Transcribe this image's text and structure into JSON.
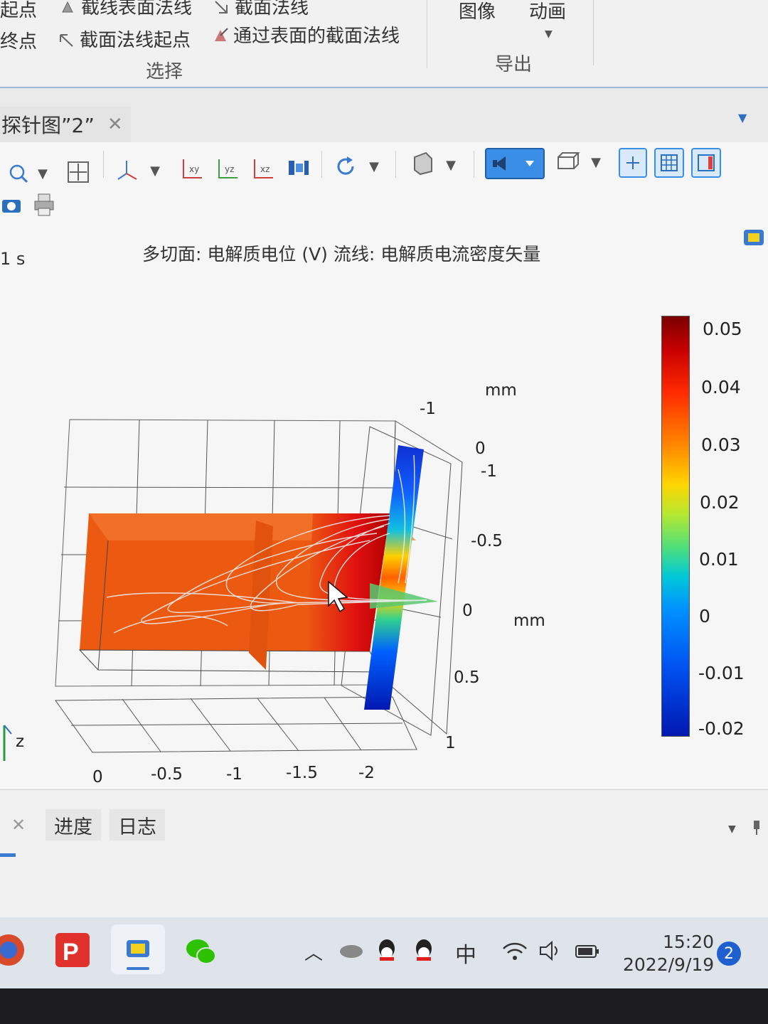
{
  "ribbon": {
    "items": {
      "top_left_partial": "起点",
      "mid_left_partial": "终点",
      "line_surface_normal": "截线表面法线",
      "section_normal_top": "截面法线",
      "section_normal_start": "截面法线起点",
      "section_normal_through_surface": "通过表面的截面法线"
    },
    "group_select": "选择",
    "export": {
      "image": "图像",
      "animation": "动画",
      "group": "导出"
    }
  },
  "tab": {
    "title": "探针图”2”"
  },
  "plot": {
    "time_label": "1 s",
    "title": "多切面: 电解质电位 (V)  流线: 电解质电流密度矢量"
  },
  "axes": {
    "unit_label_top": "mm",
    "unit_label_right": "mm",
    "vertical_ticks": [
      "-1",
      "0",
      "-1",
      "-0.5",
      "0",
      "0.5",
      "1"
    ],
    "horizontal_ticks": [
      "0",
      "-0.5",
      "-1",
      "-1.5",
      "-2"
    ],
    "axis_letter_z": "z"
  },
  "colorbar": {
    "ticks": [
      "0.05",
      "0.04",
      "0.03",
      "0.02",
      "0.01",
      "0",
      "-0.01",
      "-0.02"
    ],
    "colors": [
      "#7a0000",
      "#ff2a00",
      "#ff8a00",
      "#ffd400",
      "#4fdf7a",
      "#00c8d8",
      "#0050f0",
      "#0018b0"
    ]
  },
  "bottom_panel": {
    "tab_progress": "进度",
    "tab_log": "日志"
  },
  "taskbar": {
    "input_method": "中",
    "time": "15:20",
    "date": "2022/9/19",
    "notification_count": "2"
  }
}
